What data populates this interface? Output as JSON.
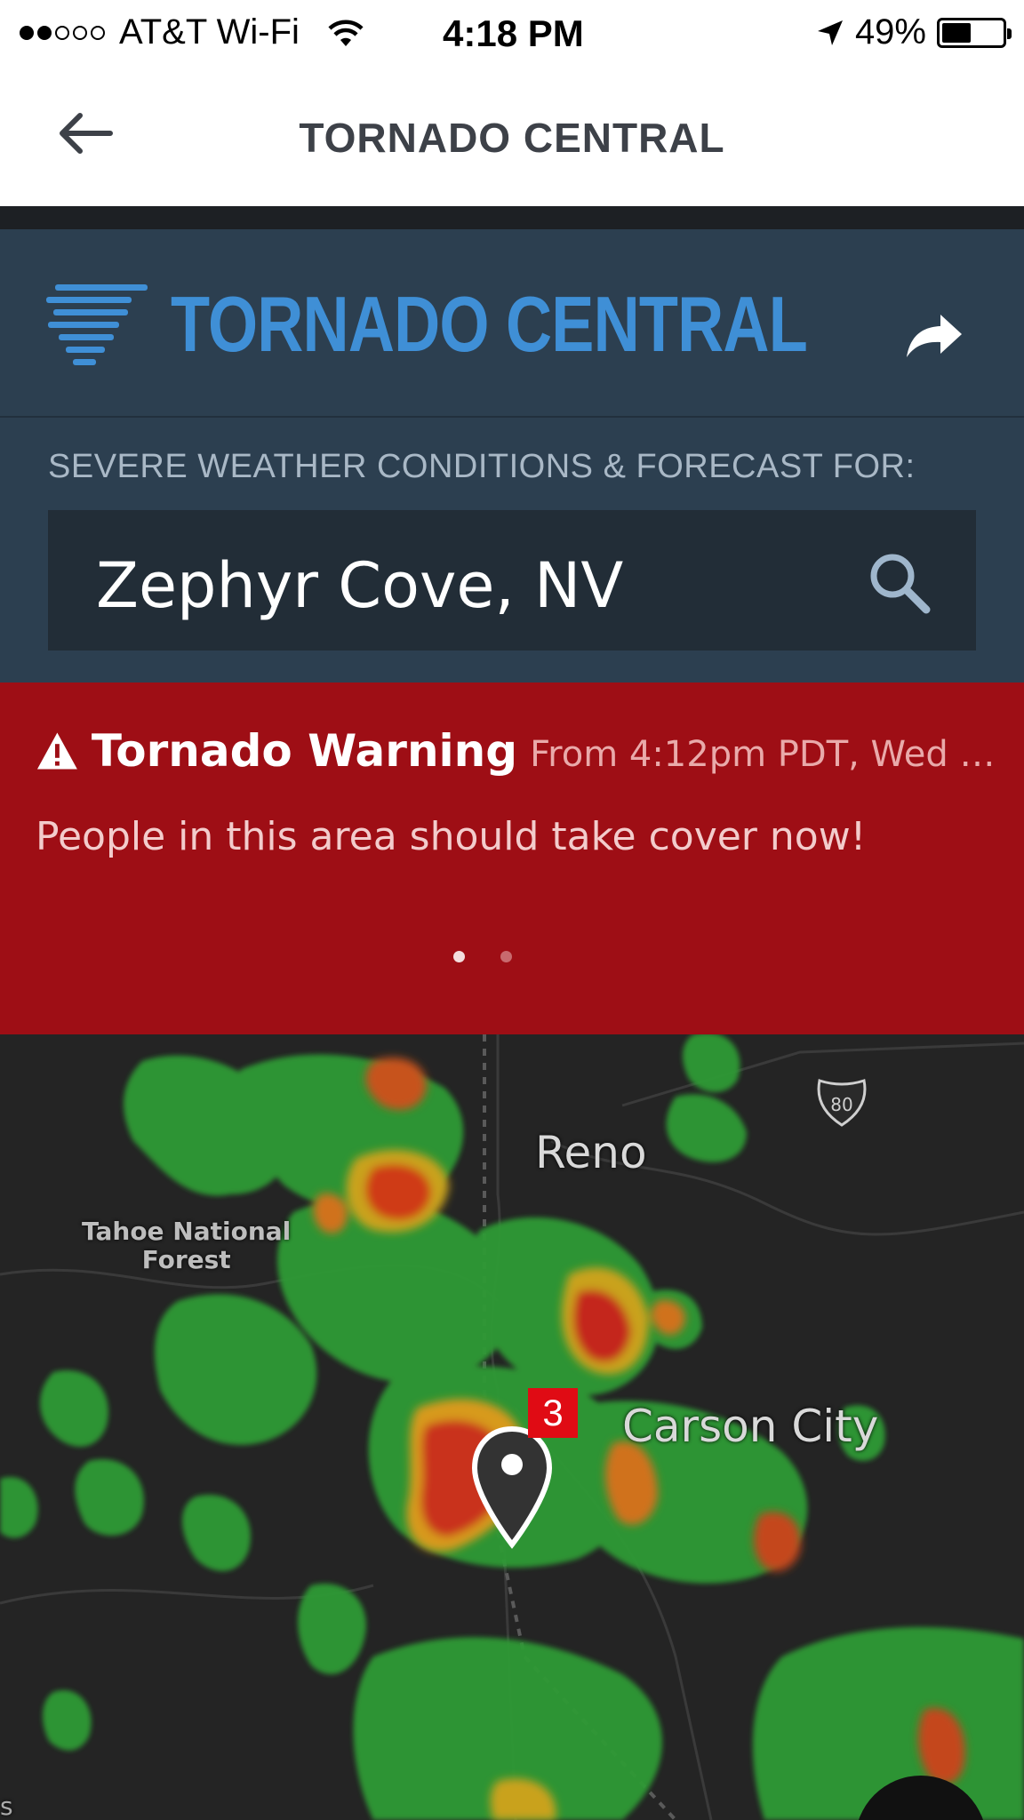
{
  "status_bar": {
    "carrier": "AT&T Wi-Fi",
    "time": "4:18 PM",
    "battery": "49%",
    "battery_level": 0.49
  },
  "nav": {
    "title": "TORNADO CENTRAL"
  },
  "brand": {
    "title": "TORNADO CENTRAL"
  },
  "search": {
    "label": "SEVERE WEATHER CONDITIONS & FORECAST FOR:",
    "value": "Zephyr Cove, NV"
  },
  "alert": {
    "title": "Tornado Warning",
    "from": "From 4:12pm PDT, Wed S...",
    "message": "People in this area should take cover now!",
    "page_count": 2,
    "active_page": 1
  },
  "map": {
    "labels": {
      "reno": "Reno",
      "city": "Carson City",
      "forest_line1": "Tahoe National",
      "forest_line2": "Forest",
      "edge": "s"
    },
    "interstate": "80",
    "alert_count": "3"
  },
  "colors": {
    "header_bg": "#2c3f50",
    "brand_blue": "#3f8fd6",
    "warning_red": "#9e0e15",
    "badge_red": "#e00b14"
  }
}
